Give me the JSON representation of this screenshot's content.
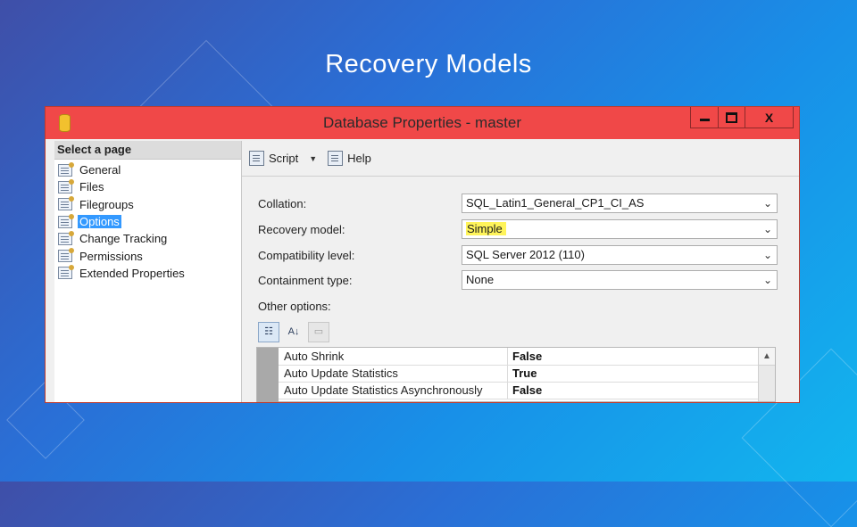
{
  "slide": {
    "title": "Recovery Models"
  },
  "window": {
    "title": "Database Properties - master",
    "controls": {
      "minimize_icon": "minimize-icon",
      "maximize_icon": "maximize-icon",
      "close_label": "X"
    }
  },
  "left_pane": {
    "header": "Select a page",
    "items": [
      {
        "label": "General"
      },
      {
        "label": "Files"
      },
      {
        "label": "Filegroups"
      },
      {
        "label": "Options",
        "selected": true
      },
      {
        "label": "Change Tracking"
      },
      {
        "label": "Permissions"
      },
      {
        "label": "Extended Properties"
      }
    ]
  },
  "toolbar": {
    "script_label": "Script",
    "help_label": "Help"
  },
  "options": {
    "collation": {
      "label": "Collation:",
      "value": "SQL_Latin1_General_CP1_CI_AS"
    },
    "recovery_model": {
      "label": "Recovery model:",
      "value": "Simple",
      "highlight_color": "#fff45a"
    },
    "compatibility_level": {
      "label": "Compatibility level:",
      "value": "SQL Server 2012 (110)"
    },
    "containment_type": {
      "label": "Containment type:",
      "value": "None"
    },
    "other_label": "Other options:"
  },
  "grid": {
    "rows": [
      {
        "name": "Auto Shrink",
        "value": "False"
      },
      {
        "name": "Auto Update Statistics",
        "value": "True"
      },
      {
        "name": "Auto Update Statistics Asynchronously",
        "value": "False"
      }
    ]
  },
  "colors": {
    "titlebar": "#f04848",
    "selection": "#3399ff",
    "highlight": "#fff45a"
  }
}
